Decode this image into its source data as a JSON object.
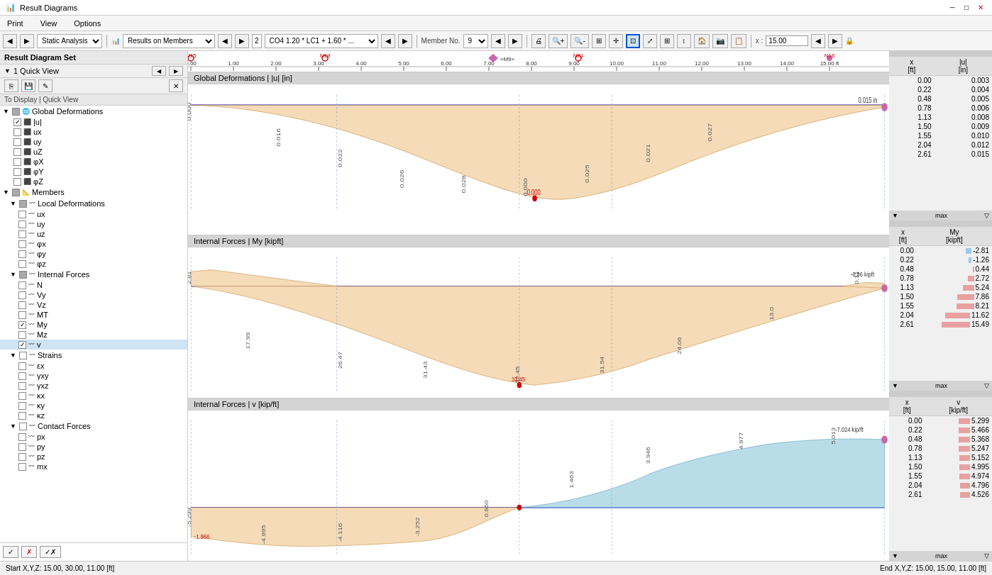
{
  "titleBar": {
    "title": "Result Diagrams",
    "minimizeLabel": "─",
    "maximizeLabel": "□",
    "closeLabel": "✕"
  },
  "menuBar": {
    "items": [
      "Print",
      "View",
      "Options"
    ]
  },
  "toolbar": {
    "analysisType": "Static Analysis",
    "resultsType": "Results on Members",
    "combo2": "2",
    "combo3": "CO4  1.20 * LC1 + 1.60 * ...",
    "memberLabel": "Member No.",
    "memberNo": "9",
    "xLabel": "x :",
    "xValue": "15.00",
    "lockIcon": "🔒"
  },
  "leftPanel": {
    "header": "Result Diagram Set",
    "quickView": "1  Quick View",
    "sectionLabel": "To Display | Quick View",
    "groups": [
      {
        "name": "Global Deformations",
        "expanded": true,
        "items": [
          {
            "label": "|u|",
            "checked": true
          },
          {
            "label": "ux",
            "checked": false
          },
          {
            "label": "uy",
            "checked": false
          },
          {
            "label": "uZ",
            "checked": false
          },
          {
            "label": "φX",
            "checked": false
          },
          {
            "label": "φY",
            "checked": false
          },
          {
            "label": "φZ",
            "checked": false
          }
        ]
      },
      {
        "name": "Members",
        "expanded": true,
        "subGroups": [
          {
            "name": "Local Deformations",
            "expanded": true,
            "items": [
              {
                "label": "ux",
                "checked": false
              },
              {
                "label": "uy",
                "checked": false
              },
              {
                "label": "uz",
                "checked": false
              },
              {
                "label": "φx",
                "checked": false
              },
              {
                "label": "φy",
                "checked": false
              },
              {
                "label": "φz",
                "checked": false
              }
            ]
          },
          {
            "name": "Internal Forces",
            "expanded": true,
            "items": [
              {
                "label": "N",
                "checked": false
              },
              {
                "label": "Vy",
                "checked": false
              },
              {
                "label": "Vz",
                "checked": false
              },
              {
                "label": "MT",
                "checked": false
              },
              {
                "label": "My",
                "checked": true
              },
              {
                "label": "Mz",
                "checked": false
              },
              {
                "label": "v",
                "checked": true,
                "selected": true
              }
            ]
          },
          {
            "name": "Strains",
            "expanded": true,
            "items": [
              {
                "label": "εx",
                "checked": false
              },
              {
                "label": "γxy",
                "checked": false
              },
              {
                "label": "γxz",
                "checked": false
              },
              {
                "label": "κx",
                "checked": false
              },
              {
                "label": "κy",
                "checked": false
              },
              {
                "label": "κz",
                "checked": false
              }
            ]
          },
          {
            "name": "Contact Forces",
            "expanded": true,
            "items": [
              {
                "label": "px",
                "checked": false
              },
              {
                "label": "py",
                "checked": false
              },
              {
                "label": "pz",
                "checked": false
              },
              {
                "label": "mx",
                "checked": false
              }
            ]
          }
        ]
      }
    ],
    "bottomButtons": [
      "✓",
      "✗",
      "✓✗"
    ]
  },
  "ruler": {
    "ticks": [
      "0.00",
      "1.00",
      "2.00",
      "3.00",
      "4.00",
      "5.00",
      "6.00",
      "7.00",
      "8.00",
      "9.00",
      "10.00",
      "11.00",
      "12.00",
      "13.00",
      "14.00",
      "15.00 ft"
    ],
    "nodes": [
      "N15",
      "N19",
      "«M9»",
      "N21",
      "N16"
    ]
  },
  "charts": [
    {
      "id": "chart1",
      "header": "Global Deformations | |u| [in]",
      "type": "deformation",
      "rightPanel": {
        "col1": "x\n[ft]",
        "col2": "|u|\n[in]",
        "rows": [
          [
            "0.00",
            "0.003"
          ],
          [
            "0.22",
            "0.004"
          ],
          [
            "0.48",
            "0.005"
          ],
          [
            "0.78",
            "0.006"
          ],
          [
            "1.13",
            "0.008"
          ],
          [
            "1.50",
            "0.009"
          ],
          [
            "1.55",
            "0.010"
          ],
          [
            "2.04",
            "0.012"
          ],
          [
            "2.61",
            "0.015"
          ]
        ],
        "footerLabel": "max"
      }
    },
    {
      "id": "chart2",
      "header": "Internal Forces | My [kipft]",
      "type": "bending",
      "rightPanel": {
        "col1": "x\n[ft]",
        "col2": "My\n[kipft]",
        "rows": [
          [
            "0.00",
            "-2.81"
          ],
          [
            "0.22",
            "-1.26"
          ],
          [
            "0.48",
            "0.44"
          ],
          [
            "0.78",
            "2.72"
          ],
          [
            "1.13",
            "5.24"
          ],
          [
            "1.50",
            "7.86"
          ],
          [
            "1.55",
            "8.21"
          ],
          [
            "2.04",
            "11.62"
          ],
          [
            "2.61",
            "15.49"
          ]
        ],
        "footerLabel": "max"
      }
    },
    {
      "id": "chart3",
      "header": "Internal Forces | v [kip/ft]",
      "type": "shear",
      "rightPanel": {
        "col1": "x\n[ft]",
        "col2": "v\n[kip/ft]",
        "rows": [
          [
            "0.00",
            "5.299"
          ],
          [
            "0.22",
            "5.466"
          ],
          [
            "0.48",
            "5.368"
          ],
          [
            "0.78",
            "5.247"
          ],
          [
            "1.13",
            "5.152"
          ],
          [
            "1.50",
            "4.995"
          ],
          [
            "1.55",
            "4.974"
          ],
          [
            "2.04",
            "4.796"
          ],
          [
            "2.61",
            "4.526"
          ]
        ],
        "footerLabel": "max"
      }
    }
  ],
  "statusBar": {
    "startLabel": "Start X,Y,Z:",
    "startCoords": "15.00, 30.00, 11.00 [ft]",
    "endLabel": "End X,Y,Z:",
    "endCoords": "15.00, 15.00, 11.00 [ft]"
  }
}
